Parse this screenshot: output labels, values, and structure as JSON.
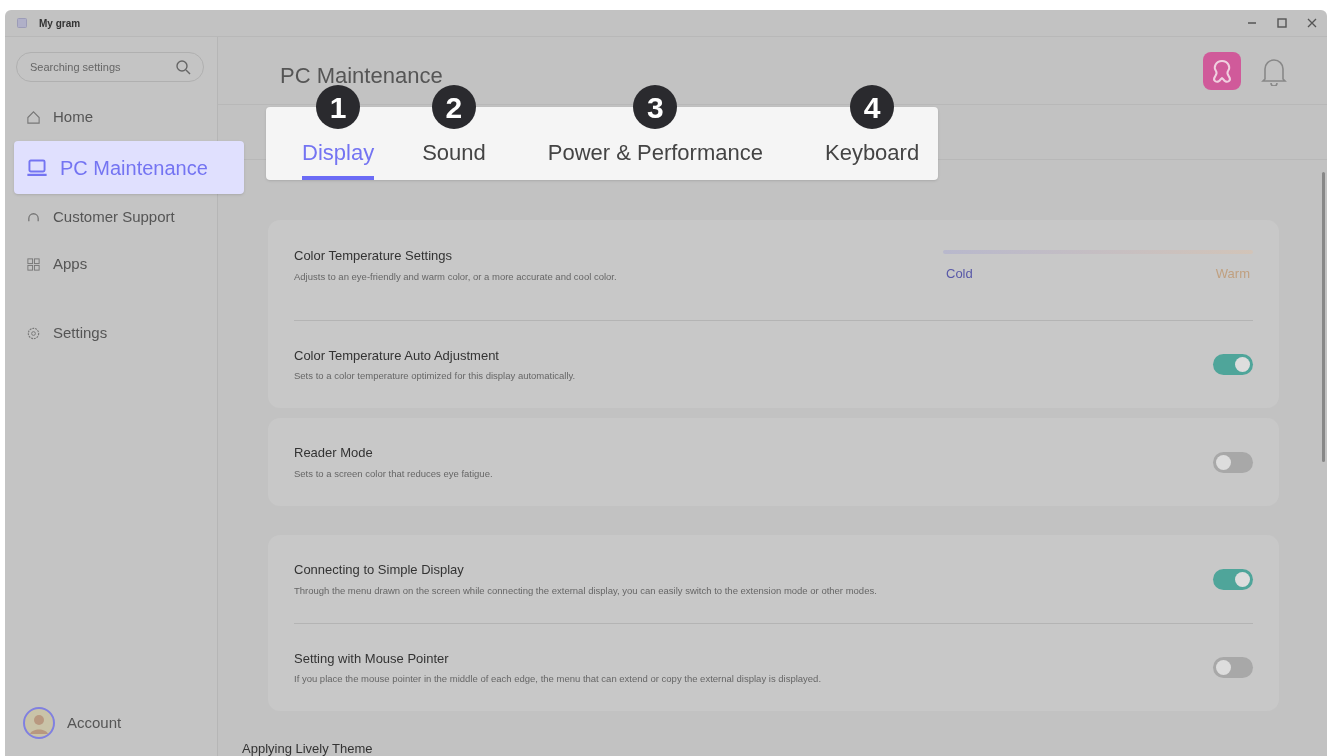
{
  "window": {
    "title": "My gram"
  },
  "sidebar": {
    "search": {
      "placeholder": "Searching settings"
    },
    "items": [
      {
        "label": "Home",
        "selected": false
      },
      {
        "label": "PC Maintenance",
        "selected": true
      },
      {
        "label": "Customer Support",
        "selected": false
      },
      {
        "label": "Apps",
        "selected": false
      },
      {
        "label": "Settings",
        "selected": false
      }
    ],
    "account": {
      "label": "Account"
    }
  },
  "page_title": "PC Maintenance",
  "tabs": [
    {
      "label": "Display",
      "badge": "1",
      "selected": true
    },
    {
      "label": "Sound",
      "badge": "2",
      "selected": false
    },
    {
      "label": "Power & Performance",
      "badge": "3",
      "selected": false
    },
    {
      "label": "Keyboard",
      "badge": "4",
      "selected": false
    }
  ],
  "cards": [
    {
      "rows": [
        {
          "kind": "slider",
          "title": "Color Temperature Settings",
          "description": "Adjusts to an eye-friendly and warm color, or a more accurate and cool color.",
          "min_label": "Cold",
          "max_label": "Warm"
        },
        {
          "kind": "toggle",
          "title": "Color Temperature Auto Adjustment",
          "description": "Sets to a color temperature optimized for this display automatically.",
          "on": true
        }
      ]
    },
    {
      "rows": [
        {
          "kind": "toggle",
          "title": "Reader Mode",
          "description": "Sets to a screen color that reduces eye fatigue.",
          "on": false
        }
      ]
    },
    {
      "rows": [
        {
          "kind": "toggle",
          "title": "Connecting to Simple Display",
          "description": "Through the menu drawn on the screen while connecting the external display, you can easily switch to the extension mode or other modes.",
          "on": true
        },
        {
          "kind": "toggle",
          "title": "Setting with Mouse Pointer",
          "description": "If you place the mouse pointer in the middle of each edge, the menu that can extend or copy the external display is displayed.",
          "on": false
        }
      ]
    }
  ],
  "section_heading": "Applying Lively Theme"
}
